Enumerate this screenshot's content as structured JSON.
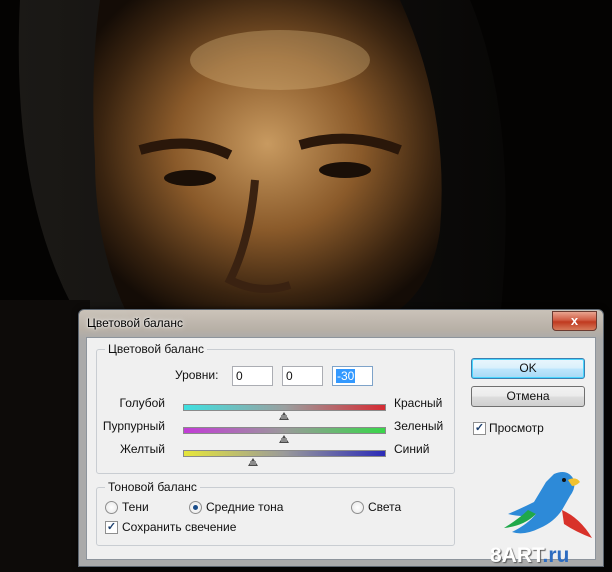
{
  "dialog": {
    "title": "Цветовой баланс",
    "close_glyph": "x"
  },
  "color_balance": {
    "group_label": "Цветовой баланс",
    "levels_label": "Уровни:",
    "levels": [
      "0",
      "0",
      "-30"
    ],
    "sliders": [
      {
        "left_label": "Голубой",
        "right_label": "Красный",
        "value": 0
      },
      {
        "left_label": "Пурпурный",
        "right_label": "Зеленый",
        "value": 0
      },
      {
        "left_label": "Желтый",
        "right_label": "Синий",
        "value": -30
      }
    ],
    "slider_range": [
      -100,
      100
    ]
  },
  "tone_balance": {
    "group_label": "Тоновой баланс",
    "options": [
      {
        "label": "Тени",
        "selected": false
      },
      {
        "label": "Средние тона",
        "selected": true
      },
      {
        "label": "Света",
        "selected": false
      }
    ],
    "preserve_label": "Сохранить свечение",
    "preserve_checked": true
  },
  "buttons": {
    "ok": "OK",
    "cancel": "Отмена"
  },
  "preview": {
    "label": "Просмотр",
    "checked": true
  },
  "watermark": {
    "text_main": "8ART",
    "text_suffix": ".ru",
    "icon": "parrot-logo-icon"
  }
}
